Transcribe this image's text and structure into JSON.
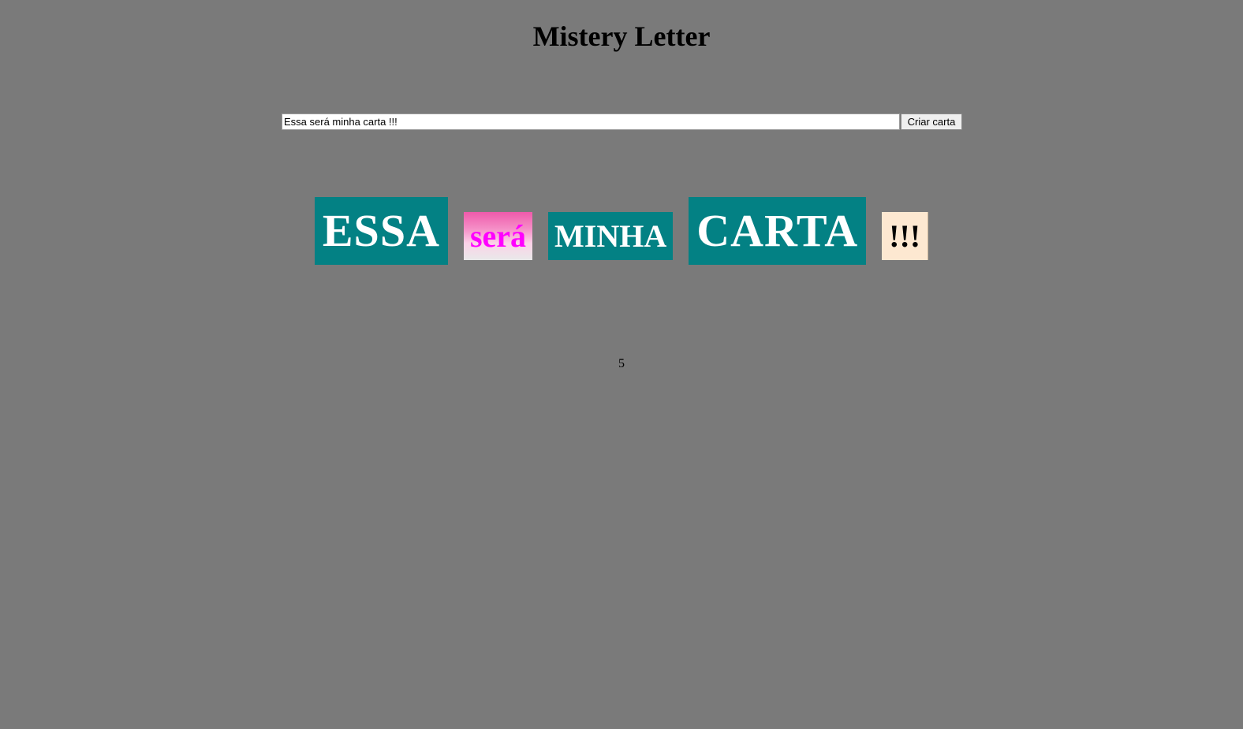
{
  "page": {
    "title": "Mistery Letter"
  },
  "form": {
    "input_value": "Essa será minha carta !!!",
    "button_label": "Criar carta"
  },
  "letter": {
    "words": [
      "ESSA",
      "será",
      "MINHA",
      "CARTA",
      "!!!"
    ],
    "count": "5"
  },
  "colors": {
    "background": "#7a7a7a",
    "word_teal": "#038184",
    "word_pink_text": "#ff00ff",
    "word_cream": "#fde8d1"
  }
}
